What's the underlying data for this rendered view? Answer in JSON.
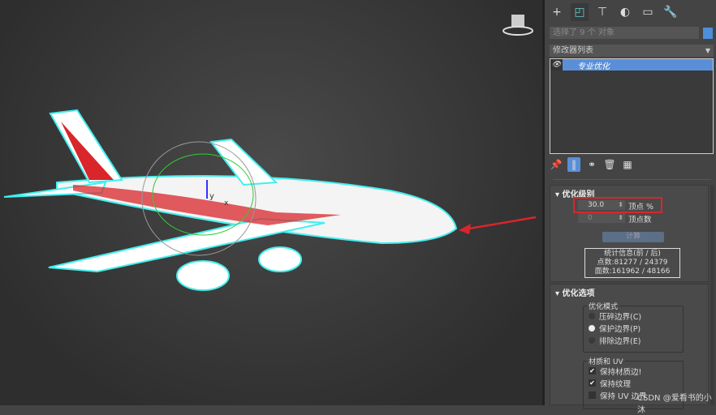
{
  "toolbar": {
    "tabs": [
      {
        "icon": "plus-icon",
        "glyph": "+"
      },
      {
        "icon": "modify-icon",
        "glyph": "◰"
      },
      {
        "icon": "hierarchy-icon",
        "glyph": "⊤"
      },
      {
        "icon": "motion-icon",
        "glyph": "◐"
      },
      {
        "icon": "display-icon",
        "glyph": "▭"
      },
      {
        "icon": "utilities-icon",
        "glyph": "🔧"
      }
    ]
  },
  "selection": {
    "text": "选择了 9 个 对象"
  },
  "modifier_list": {
    "label": "修改器列表",
    "items": [
      {
        "name": "专业优化"
      }
    ]
  },
  "stack_tools": {
    "pin": "📌",
    "show": "‖",
    "unique": "⚭",
    "remove": "🗑",
    "config": "▦"
  },
  "level": {
    "title": "优化级别",
    "vertex_percent": "30.0",
    "vertex_percent_label": "顶点 %",
    "vertex_count": "0",
    "vertex_count_label": "顶点数",
    "calc_button": "计算",
    "stats_title": "统计信息(前 / 后)",
    "points": "点数:81277 / 24379",
    "faces": "面数:161962 / 48166"
  },
  "options": {
    "title": "优化选项",
    "mode_label": "优化模式",
    "modes": [
      {
        "label": "压碎边界(C)",
        "selected": false
      },
      {
        "label": "保护边界(P)",
        "selected": true
      },
      {
        "label": "排除边界(E)",
        "selected": false
      }
    ],
    "mat_label": "材质和 UV",
    "mat_opts": [
      {
        "label": "保持材质边!",
        "checked": true
      },
      {
        "label": "保持纹理",
        "checked": true
      },
      {
        "label": "保持 UV 边界",
        "checked": false
      }
    ]
  },
  "viewport": {
    "axis_y": "y",
    "axis_x": "x"
  },
  "watermark": "CSDN @爱看书的小沐",
  "colors": {
    "accent": "#5a8fd8",
    "highlight": "#d8262b"
  }
}
